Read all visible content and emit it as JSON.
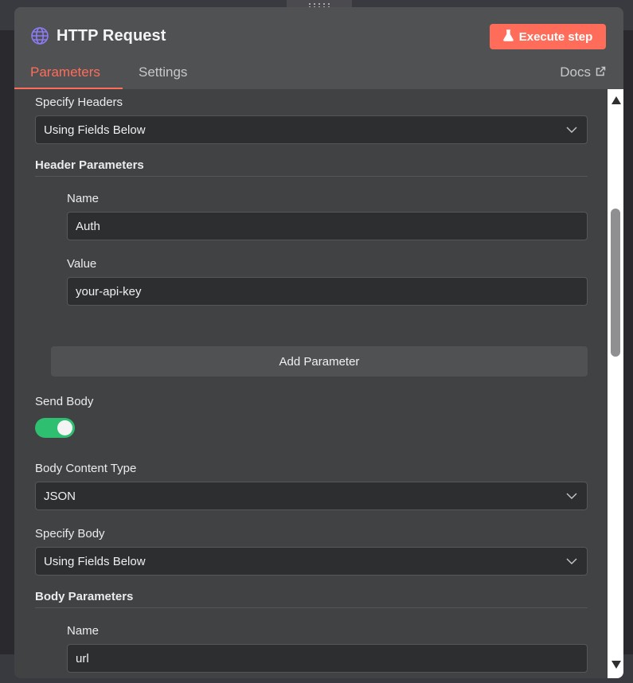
{
  "node": {
    "title": "HTTP Request",
    "execute_label": "Execute step",
    "icon": "globe-icon",
    "execute_icon": "flask-icon"
  },
  "tabs": {
    "parameters": "Parameters",
    "settings": "Settings",
    "docs": "Docs",
    "active": "Parameters"
  },
  "form": {
    "specify_headers": {
      "label": "Specify Headers",
      "value": "Using Fields Below"
    },
    "header_parameters": {
      "label": "Header Parameters",
      "name_label": "Name",
      "name_value": "Auth",
      "value_label": "Value",
      "value_value": "your-api-key",
      "add_label": "Add Parameter"
    },
    "send_body": {
      "label": "Send Body",
      "enabled": true
    },
    "body_content_type": {
      "label": "Body Content Type",
      "value": "JSON"
    },
    "specify_body": {
      "label": "Specify Body",
      "value": "Using Fields Below"
    },
    "body_parameters": {
      "label": "Body Parameters",
      "name_label": "Name",
      "name_value": "url"
    }
  },
  "colors": {
    "accent": "#ff6d5a",
    "toggle_on": "#2fbf71",
    "panel_bg": "#414244",
    "header_bg": "#505153",
    "input_bg": "#2d2e30",
    "globe": "#8b7cf6"
  }
}
